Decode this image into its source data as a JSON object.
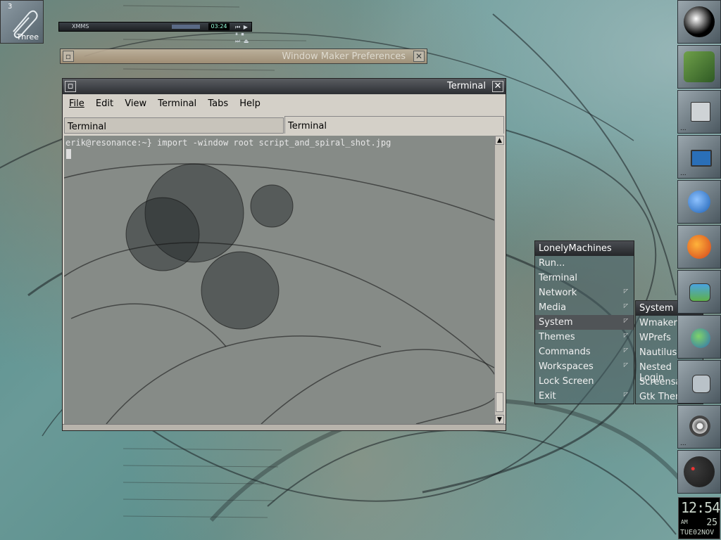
{
  "workspace": {
    "number": "3",
    "name": "Three"
  },
  "xmms": {
    "title": "XMMS",
    "time": "03:24",
    "controls": "⏮ ▶ ⏸ ⏹ ⏭ ⏏"
  },
  "wm_prefs": {
    "title": "Window Maker Preferences"
  },
  "terminal": {
    "title": "Terminal",
    "menu": [
      "File",
      "Edit",
      "View",
      "Terminal",
      "Tabs",
      "Help"
    ],
    "tabs": [
      "Terminal",
      "Terminal"
    ],
    "prompt_line": "erik@resonance:~} import -window root script_and_spiral_shot.jpg"
  },
  "root_menu": {
    "title": "LonelyMachines",
    "items": [
      {
        "label": "Run...",
        "submenu": false
      },
      {
        "label": "Terminal",
        "submenu": false
      },
      {
        "label": "Network",
        "submenu": true
      },
      {
        "label": "Media",
        "submenu": true
      },
      {
        "label": "System",
        "submenu": true,
        "selected": true
      },
      {
        "label": "Themes",
        "submenu": true
      },
      {
        "label": "Commands",
        "submenu": true
      },
      {
        "label": "Workspaces",
        "submenu": true
      },
      {
        "label": "Lock Screen",
        "submenu": false
      },
      {
        "label": "Exit",
        "submenu": true
      }
    ]
  },
  "system_menu": {
    "title": "System",
    "items": [
      "WmakerConf",
      "WPrefs",
      "Nautilus",
      "Nested Login",
      "Screensaver",
      "Gtk Theme"
    ]
  },
  "clock": {
    "time": "12:54",
    "ampm": "AM",
    "day_num": "25",
    "date": "TUE02NOV"
  },
  "colors": {
    "titlebar": "#2d2f33",
    "menu_bg": "#465f64",
    "desktop": "#5b8f8c"
  }
}
